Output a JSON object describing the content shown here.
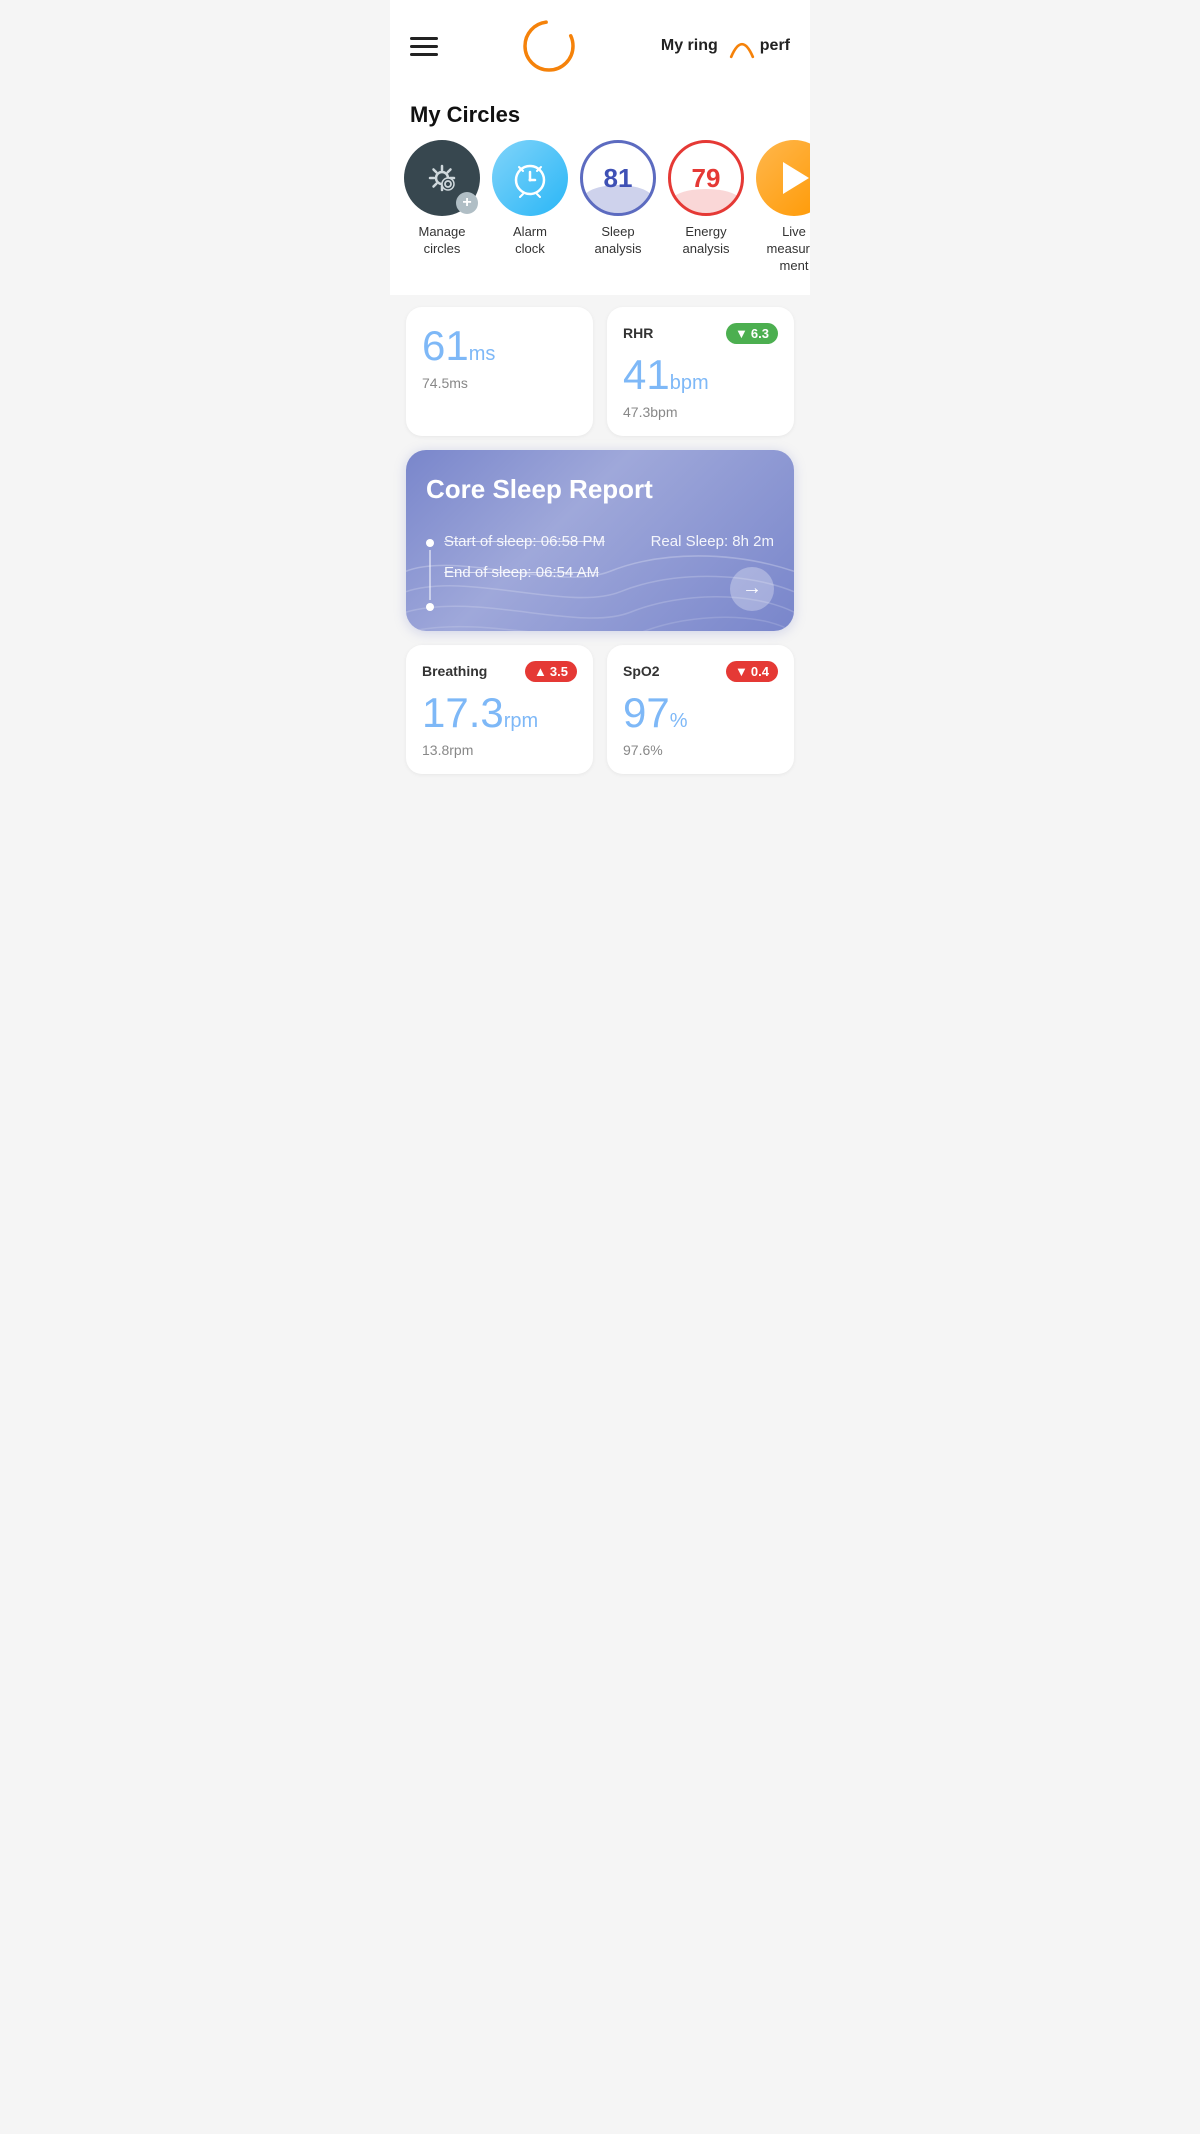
{
  "header": {
    "my_ring_label": "My ring",
    "perf_label": "perf"
  },
  "circles_section": {
    "title": "My Circles",
    "items": [
      {
        "id": "manage",
        "label": "Manage\ncircles",
        "icon": "settings-icon"
      },
      {
        "id": "alarm",
        "label": "Alarm\nclock",
        "icon": "alarm-icon"
      },
      {
        "id": "sleep",
        "label": "Sleep\nanalysis",
        "value": "81",
        "icon": "sleep-icon"
      },
      {
        "id": "energy",
        "label": "Energy\nanalysis",
        "value": "79",
        "icon": "energy-icon"
      },
      {
        "id": "live",
        "label": "Live\nmeasurement",
        "icon": "play-icon"
      }
    ]
  },
  "hrv_card": {
    "value": "61",
    "unit": "ms",
    "sub_value": "74.5ms"
  },
  "rhr_card": {
    "title": "RHR",
    "badge_value": "6.3",
    "badge_direction": "down",
    "value": "41",
    "unit": "bpm",
    "sub_value": "47.3bpm"
  },
  "sleep_report": {
    "title": "Core Sleep Report",
    "start_label": "Start of sleep:",
    "start_time": "06:58 PM",
    "real_sleep_label": "Real Sleep:",
    "real_sleep_value": "8h 2m",
    "end_label": "End of sleep:",
    "end_time": "06:54 AM"
  },
  "breathing_card": {
    "title": "Breathing",
    "badge_value": "3.5",
    "badge_direction": "up",
    "value": "17.3",
    "unit": "rpm",
    "sub_value": "13.8rpm"
  },
  "spo2_card": {
    "title": "SpO2",
    "badge_value": "0.4",
    "badge_direction": "down",
    "value": "97",
    "unit": "%",
    "sub_value": "97.6%"
  }
}
